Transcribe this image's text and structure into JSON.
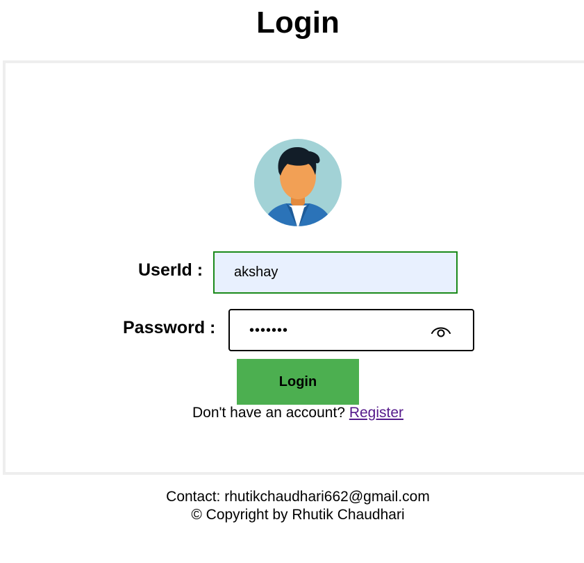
{
  "page": {
    "title": "Login"
  },
  "form": {
    "userid_label": "UserId :",
    "userid_value": "akshay",
    "password_label": "Password :",
    "password_value": "1234567",
    "password_toggle_icon": "eye-icon",
    "login_button": "Login",
    "register_prompt": "Don't have an account?",
    "register_link": "Register"
  },
  "avatar": {
    "icon": "user-avatar-icon"
  },
  "footer": {
    "contact": "Contact: rhutikchaudhari662@gmail.com",
    "copyright": "© Copyright by Rhutik Chaudhari"
  },
  "colors": {
    "button": "#4caf50",
    "userid_border": "#1a8a1a",
    "userid_background": "#e8f0fe",
    "link": "#551a8b"
  }
}
